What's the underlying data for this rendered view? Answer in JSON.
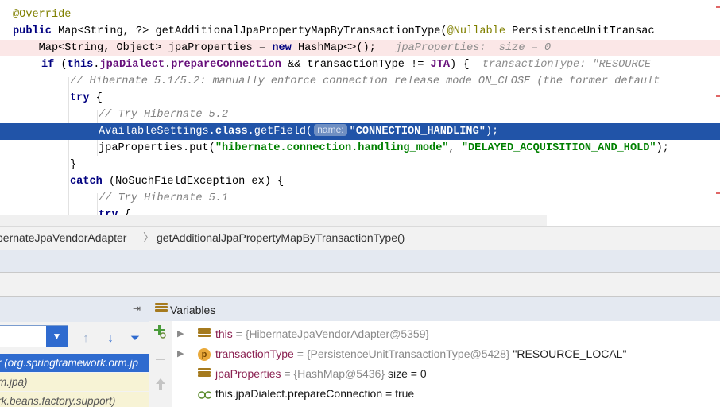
{
  "editor": {
    "annotation_override": "@Override",
    "l2": {
      "kw_public": "public",
      "sig_a": " Map<String, ?> getAdditionalJpaPropertyMapByTransactionType(",
      "ann_nullable": "@Nullable",
      "sig_b": " PersistenceUnitTransac"
    },
    "l3": {
      "a": "    Map<String, Object> jpaProperties = ",
      "kw_new": "new",
      "b": " HashMap<>();",
      "hint": "   jpaProperties:  size = 0"
    },
    "l4": {
      "kw_if": "if",
      "a": " (",
      "kw_this": "this",
      "dot": ".",
      "fld_dialect": "jpaDialect",
      "dot2": ".",
      "fld_prepare": "prepareConnection",
      "b": " && transactionType != ",
      "fld_jta": "JTA",
      "c": ") {",
      "hint": "  transactionType: \"RESOURCE_"
    },
    "l5_comment": "// Hibernate 5.1/5.2: manually enforce connection release mode ON_CLOSE (the former default",
    "l6_kw_try": "try",
    "l6_brace": " {",
    "l7_comment": "// Try Hibernate 5.2",
    "l8": {
      "a": "AvailableSettings.",
      "kw_class": "class",
      "b": ".getField(",
      "param_hint": "name:",
      "str": "\"CONNECTION_HANDLING\"",
      "c": ");"
    },
    "l9": {
      "a": "jpaProperties.put(",
      "str1": "\"hibernate.connection.handling_mode\"",
      "comma": ", ",
      "str2": "\"DELAYED_ACQUISITION_AND_HOLD\"",
      "c": ");"
    },
    "l10_brace": "}",
    "l11": {
      "kw_catch": "catch",
      "a": " (NoSuchFieldException ex) {"
    },
    "l12_comment": "// Try Hibernate 5.1",
    "l13_kw_try": "try",
    "l13_brace": " {"
  },
  "breadcrumb": {
    "class_name": "bernateJpaVendorAdapter",
    "separator": "〉",
    "method_name": "getAdditionalJpaPropertyMapByTransactionType()"
  },
  "frames": {
    "pin_glyph": "⇥",
    "dropdown_glyph": "▼",
    "tools": {
      "up": "↑",
      "down": "↓",
      "filter": "⏷"
    },
    "rows": [
      {
        "text": "r (org.springframework.orm.jp"
      },
      {
        "text": "m.jpa)"
      },
      {
        "text": "rk.beans.factory.support)"
      }
    ]
  },
  "variables": {
    "title": "Variables",
    "rows": [
      {
        "name": "this",
        "eq": " = ",
        "value": "{HibernateJpaVendorAdapter@5359}",
        "extra": ""
      },
      {
        "name": "transactionType",
        "eq": " = ",
        "value": "{PersistenceUnitTransactionType@5428}",
        "extra": " \"RESOURCE_LOCAL\""
      },
      {
        "name": "jpaProperties",
        "eq": " = ",
        "value": "{HashMap@5436}",
        "extra": "  size = 0"
      },
      {
        "name": "this.jpaDialect.prepareConnection",
        "eq": " = ",
        "value": "true",
        "extra": ""
      }
    ]
  },
  "colors": {
    "execution_line": "#2154a8",
    "selected_frame": "#2f6bcf",
    "keyword": "#000080",
    "string": "#008000",
    "comment": "#808080"
  }
}
